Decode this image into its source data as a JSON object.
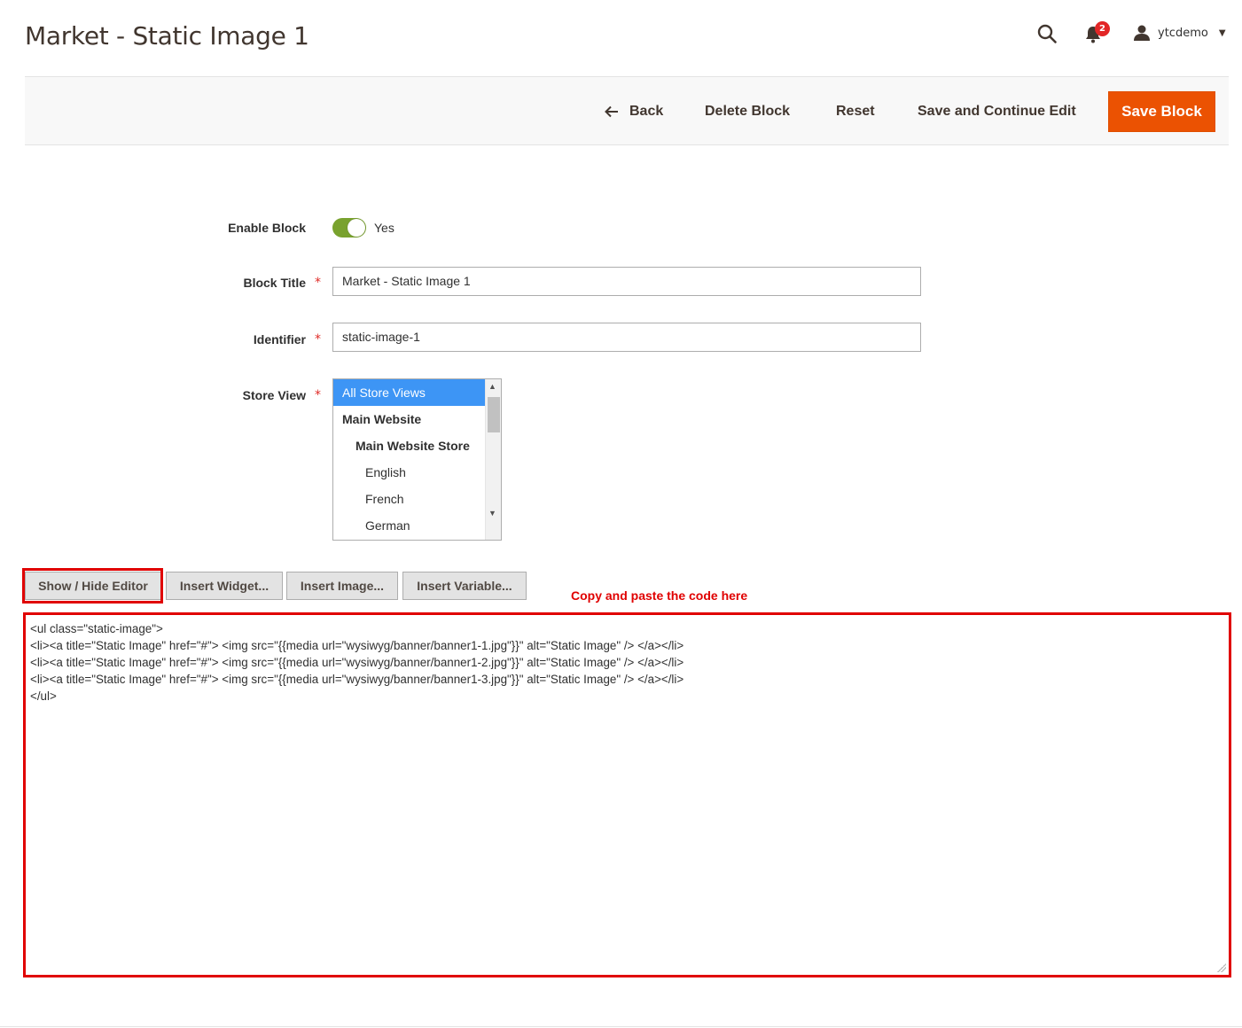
{
  "header": {
    "title": "Market - Static Image 1",
    "notification_count": "2",
    "username": "ytcdemo"
  },
  "toolbar": {
    "back_label": "Back",
    "delete_label": "Delete Block",
    "reset_label": "Reset",
    "save_continue_label": "Save and Continue Edit",
    "save_label": "Save Block"
  },
  "form": {
    "enable_block": {
      "label": "Enable Block",
      "value": "Yes",
      "enabled": true
    },
    "block_title": {
      "label": "Block Title",
      "value": "Market - Static Image 1"
    },
    "identifier": {
      "label": "Identifier",
      "value": "static-image-1"
    },
    "required_marker": "*",
    "store_view": {
      "label": "Store View",
      "options": [
        {
          "label": "All Store Views",
          "selected": true
        },
        {
          "label": "Main Website"
        },
        {
          "label": "Main Website Store"
        },
        {
          "label": "English"
        },
        {
          "label": "French"
        },
        {
          "label": "German"
        }
      ]
    }
  },
  "editor": {
    "show_hide_label": "Show / Hide Editor",
    "insert_widget_label": "Insert Widget...",
    "insert_image_label": "Insert Image...",
    "insert_variable_label": "Insert Variable...",
    "annotation": "Copy and paste the code here",
    "content": "<ul class=\"static-image\">\n<li><a title=\"Static Image\" href=\"#\"> <img src=\"{{media url=\"wysiwyg/banner/banner1-1.jpg\"}}\" alt=\"Static Image\" /> </a></li>\n<li><a title=\"Static Image\" href=\"#\"> <img src=\"{{media url=\"wysiwyg/banner/banner1-2.jpg\"}}\" alt=\"Static Image\" /> </a></li>\n<li><a title=\"Static Image\" href=\"#\"> <img src=\"{{media url=\"wysiwyg/banner/banner1-3.jpg\"}}\" alt=\"Static Image\" /> </a></li>\n</ul>"
  },
  "colors": {
    "primary_button": "#eb5202",
    "toggle_on": "#79a22e",
    "selected_option": "#3d95f5",
    "annotation_red": "#e00000"
  }
}
